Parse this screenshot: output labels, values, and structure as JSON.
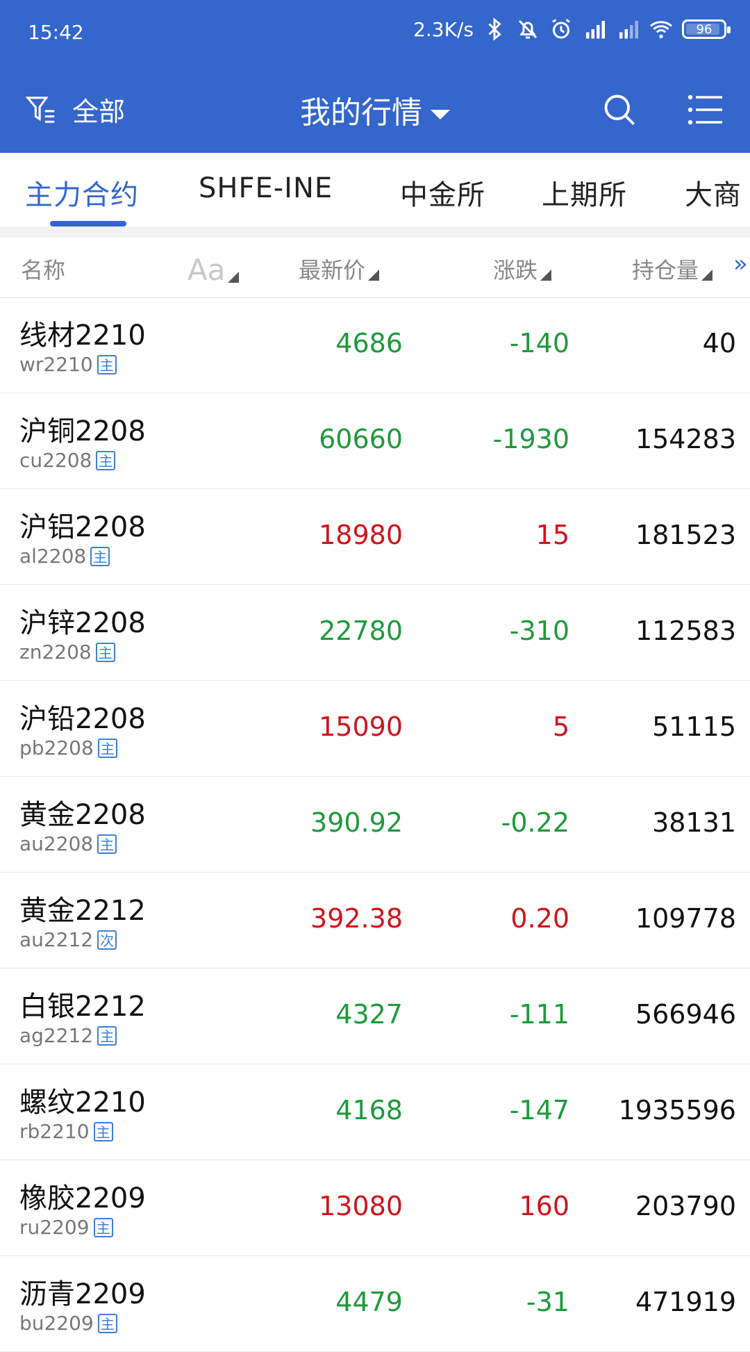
{
  "status_bar": {
    "time": "15:42",
    "net_speed": "2.3K/s",
    "battery": "96",
    "icons": [
      "bluetooth-icon",
      "mute-bell-icon",
      "alarm-icon",
      "hd-signal-icon",
      "signal-icon",
      "signal-icon-2",
      "wifi-icon",
      "battery-icon"
    ]
  },
  "header": {
    "filter_label": "全部",
    "title": "我的行情",
    "accent": "#3466cc"
  },
  "tabs": [
    "主力合约",
    "SHFE-INE",
    "中金所",
    "上期所",
    "大商"
  ],
  "active_tab": 0,
  "columns": {
    "name": "名称",
    "font": "Aa",
    "price": "最新价",
    "change": "涨跌",
    "open_interest": "持仓量",
    "more": "»"
  },
  "colors": {
    "up": "#d0141c",
    "down": "#1e9a3c",
    "tag": "#3d7fd6"
  },
  "rows": [
    {
      "name": "线材2210",
      "code": "wr2210",
      "tag": "主",
      "price": "4686",
      "change": "-140",
      "oi": "40",
      "dir": "down"
    },
    {
      "name": "沪铜2208",
      "code": "cu2208",
      "tag": "主",
      "price": "60660",
      "change": "-1930",
      "oi": "154283",
      "dir": "down"
    },
    {
      "name": "沪铝2208",
      "code": "al2208",
      "tag": "主",
      "price": "18980",
      "change": "15",
      "oi": "181523",
      "dir": "up"
    },
    {
      "name": "沪锌2208",
      "code": "zn2208",
      "tag": "主",
      "price": "22780",
      "change": "-310",
      "oi": "112583",
      "dir": "down"
    },
    {
      "name": "沪铅2208",
      "code": "pb2208",
      "tag": "主",
      "price": "15090",
      "change": "5",
      "oi": "51115",
      "dir": "up"
    },
    {
      "name": "黄金2208",
      "code": "au2208",
      "tag": "主",
      "price": "390.92",
      "change": "-0.22",
      "oi": "38131",
      "dir": "down"
    },
    {
      "name": "黄金2212",
      "code": "au2212",
      "tag": "次",
      "price": "392.38",
      "change": "0.20",
      "oi": "109778",
      "dir": "up"
    },
    {
      "name": "白银2212",
      "code": "ag2212",
      "tag": "主",
      "price": "4327",
      "change": "-111",
      "oi": "566946",
      "dir": "down"
    },
    {
      "name": "螺纹2210",
      "code": "rb2210",
      "tag": "主",
      "price": "4168",
      "change": "-147",
      "oi": "1935596",
      "dir": "down"
    },
    {
      "name": "橡胶2209",
      "code": "ru2209",
      "tag": "主",
      "price": "13080",
      "change": "160",
      "oi": "203790",
      "dir": "up"
    },
    {
      "name": "沥青2209",
      "code": "bu2209",
      "tag": "主",
      "price": "4479",
      "change": "-31",
      "oi": "471919",
      "dir": "down"
    }
  ]
}
